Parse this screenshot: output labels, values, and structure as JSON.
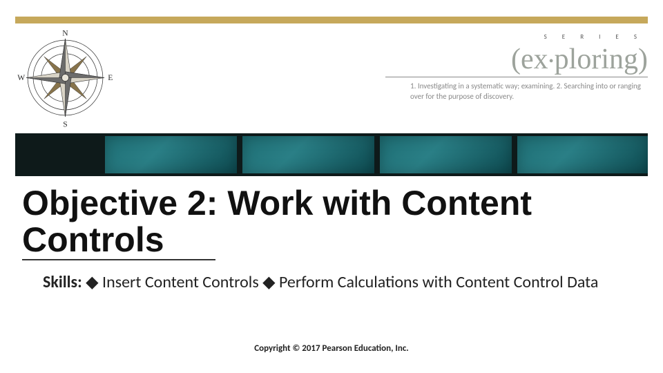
{
  "header": {
    "series_label": "S  E  R  I  E  S",
    "brand_word": "(ex•ploring)",
    "definition": "1. Investigating in a systematic way; examining. 2. Searching into or ranging over for the purpose of discovery.",
    "compass": {
      "n": "N",
      "e": "E",
      "s": "S",
      "w": "W"
    }
  },
  "title": "Objective 2: Work with Content Controls",
  "skills": {
    "label": "Skills:",
    "text": " ◆ Insert Content Controls ◆ Perform Calculations with Content Control Data"
  },
  "footer": "Copyright © 2017 Pearson Education, Inc."
}
